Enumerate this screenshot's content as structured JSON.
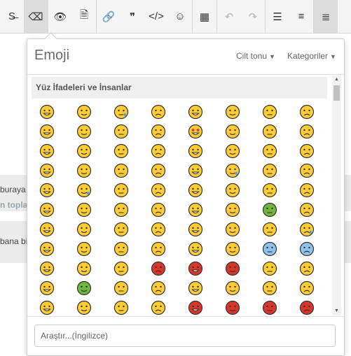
{
  "toolbar": {
    "buttons": [
      {
        "name": "strikethrough-button",
        "glyph": "S̶",
        "active": false,
        "disabled": false
      },
      {
        "name": "eraser-button",
        "glyph": "⌫",
        "active": true,
        "disabled": false
      },
      {
        "name": "preview-button",
        "glyph": "👁",
        "active": false,
        "disabled": false
      },
      {
        "name": "document-button",
        "glyph": "🗎",
        "active": false,
        "disabled": false
      },
      {
        "name": "link-button",
        "glyph": "🔗",
        "active": false,
        "disabled": false
      },
      {
        "name": "quote-button",
        "glyph": "❞",
        "active": false,
        "disabled": false
      },
      {
        "name": "code-button",
        "glyph": "</>",
        "active": false,
        "disabled": false
      },
      {
        "name": "emoji-button",
        "glyph": "☺",
        "active": false,
        "disabled": false
      },
      {
        "name": "table-button",
        "glyph": "▦",
        "active": false,
        "disabled": false
      },
      {
        "name": "undo-button",
        "glyph": "↶",
        "active": false,
        "disabled": true
      },
      {
        "name": "redo-button",
        "glyph": "↷",
        "active": false,
        "disabled": true
      },
      {
        "name": "bullet-list-button",
        "glyph": "☰",
        "active": false,
        "disabled": false
      },
      {
        "name": "numbered-list-button",
        "glyph": "≡",
        "active": false,
        "disabled": false
      },
      {
        "name": "align-button",
        "glyph": "≣",
        "active": true,
        "disabled": false
      }
    ]
  },
  "background": {
    "line1": "buraya",
    "line2": "n topla",
    "line3": "bana bi"
  },
  "popup": {
    "title": "Emoji",
    "skin_tone_label": "Cilt tonu",
    "categories_label": "Kategoriler",
    "category_header": "Yüz İfadeleri ve İnsanlar",
    "search_placeholder": "Araştır...(İngilizce)"
  },
  "emoji_rows": [
    [
      "grinning-face",
      "beaming-face",
      "tears-of-joy",
      "rolling-laughing",
      "grinning-face-big-eyes",
      "grinning-smiling-eyes",
      "grinning-sweat",
      "squinting-face"
    ],
    [
      "winking-face",
      "smiling-eyes",
      "yum-face",
      "sunglasses-face",
      "heart-eyes",
      "kissing-heart",
      "kissing-face",
      "kissing-smiling-eyes"
    ],
    [
      "kissing-closed-eyes",
      "smiling-face",
      "slightly-smiling",
      "hugging-face",
      "star-struck",
      "thinking-face",
      "raised-eyebrow",
      "neutral-face"
    ],
    [
      "expressionless",
      "no-mouth",
      "rolling-eyes",
      "smirking-face",
      "persevering-face",
      "sad-relieved",
      "hushed-face",
      "zipper-mouth"
    ],
    [
      "open-mouth",
      "sleepy-face",
      "tired-face",
      "sleeping-face",
      "relieved-face",
      "tongue-out",
      "winking-tongue",
      "squinting-tongue"
    ],
    [
      "drooling-face",
      "unamused-face",
      "downcast-sweat",
      "pensive-face",
      "confused-face",
      "upside-down",
      "nauseated-face",
      "astonished-face"
    ],
    [
      "frowning-face",
      "slightly-frowning",
      "confounded-face",
      "disappointed-face",
      "worried-face",
      "steam-nose",
      "crying-face",
      "loudly-crying"
    ],
    [
      "frowning-open",
      "anguished-face",
      "fearful-face",
      "weary-face",
      "exploding-head",
      "grimacing-face",
      "anxious-sweat",
      "screaming-fear"
    ],
    [
      "flushed-face",
      "zany-face",
      "dizzy-face",
      "pouting-face",
      "angry-face",
      "cursing-face",
      "mask-face",
      "thermometer-face"
    ],
    [
      "bandage-face",
      "vomiting-face",
      "sneezing-face",
      "yawning-face",
      "halo-face",
      "cowboy-face",
      "clown-face",
      "lying-face"
    ],
    [
      "shushing-face",
      "hand-over-mouth",
      "monocle-face",
      "nerd-face",
      "smiling-devil",
      "angry-devil",
      "ogre",
      "goblin"
    ]
  ],
  "colors": {
    "face": "#ffcc33",
    "outline": "#333333",
    "red_face": "#d9362b",
    "green_face": "#6fb73c",
    "blue_face": "#8fc3ef",
    "heart": "#e2403c",
    "tear": "#4aa6e8"
  }
}
